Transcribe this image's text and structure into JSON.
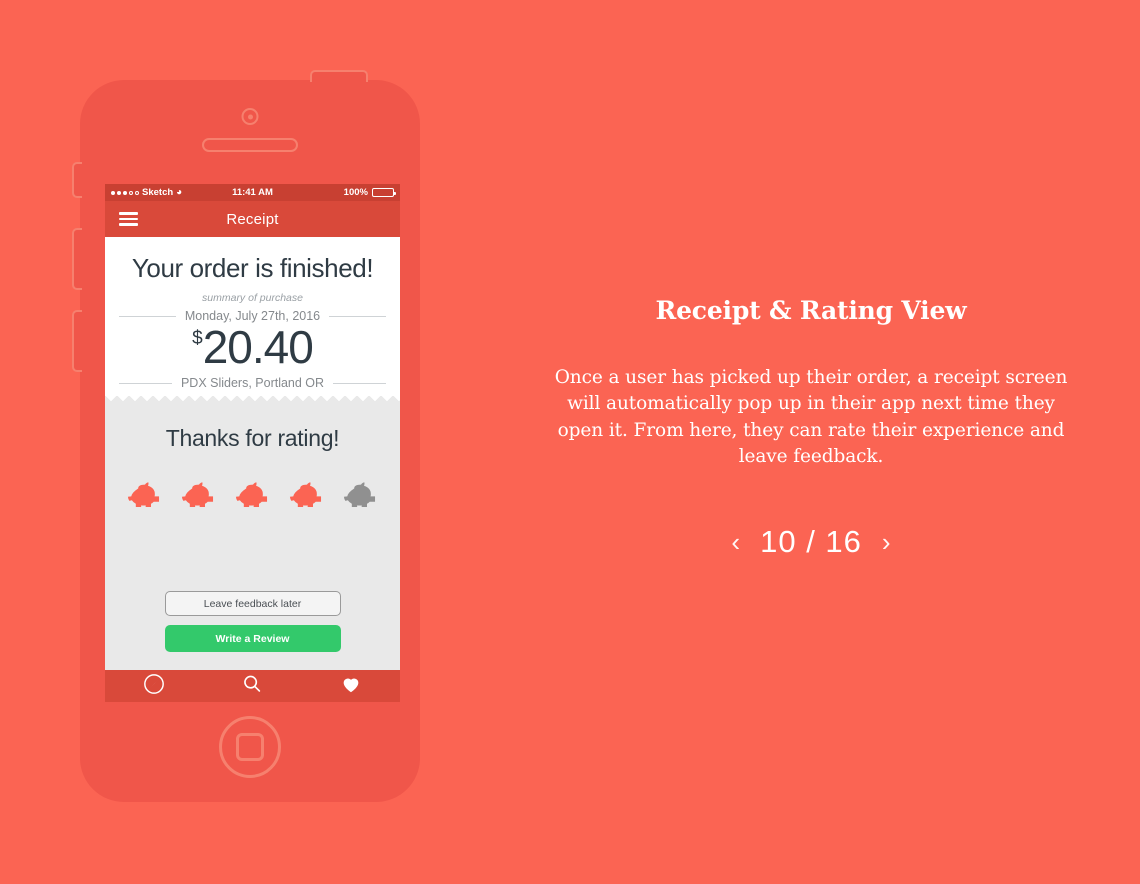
{
  "theme": {
    "background": "#fb6453",
    "phone_body": "#f0564a",
    "phone_outline": "#f6806e",
    "nav_bar": "#d9493a",
    "status_bar": "#c84032",
    "rating_bg": "#e9e9e9",
    "primary_button": "#33c96b",
    "pig_active": "#fb6453",
    "pig_inactive": "#909090",
    "text_dark": "#2f3b44",
    "text_muted": "#85898d"
  },
  "phone": {
    "status_bar": {
      "carrier": "Sketch",
      "signal_dots_filled": 3,
      "signal_dots_total": 5,
      "wifi_icon": "wifi-icon",
      "time": "11:41 AM",
      "battery_percent": "100%",
      "battery_icon": "battery-icon"
    },
    "nav_bar": {
      "menu_icon": "hamburger-menu-icon",
      "title": "Receipt"
    },
    "receipt": {
      "headline": "Your order is finished!",
      "subtitle": "summary of purchase",
      "date": "Monday, July 27th, 2016",
      "currency_symbol": "$",
      "amount": "20.40",
      "merchant": "PDX Sliders, Portland OR"
    },
    "rating": {
      "headline": "Thanks for rating!",
      "icon_name": "piggy-bank-icon",
      "total": 5,
      "filled": 4,
      "buttons": {
        "secondary": "Leave feedback later",
        "primary": "Write a Review"
      }
    },
    "tab_bar": {
      "items": [
        {
          "icon": "compass-navigation-icon"
        },
        {
          "icon": "search-icon"
        },
        {
          "icon": "heart-icon"
        }
      ]
    }
  },
  "info": {
    "title": "Receipt & Rating View",
    "description": "Once a user has picked up their order, a receipt screen will automatically pop up in their app next time they open it. From here, they can rate their experience and leave feedback.",
    "pager": {
      "prev_icon": "chevron-left-icon",
      "next_icon": "chevron-right-icon",
      "current": "10",
      "separator": "/",
      "total": "16",
      "label": "10 / 16"
    }
  }
}
